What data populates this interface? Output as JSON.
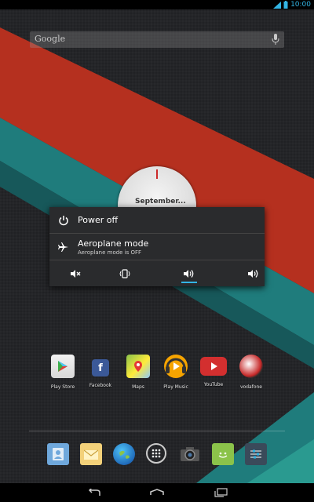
{
  "status_bar": {
    "time": "10:00"
  },
  "search": {
    "logo_text": "Google"
  },
  "clock_widget": {
    "date_label": "September..."
  },
  "power_menu": {
    "power_off_label": "Power off",
    "aeroplane_label": "Aeroplane mode",
    "aeroplane_status": "Aeroplane mode is OFF",
    "sound_modes": [
      "mute",
      "vibrate",
      "sound-on",
      "sound-on-alt"
    ],
    "selected_sound_mode": "sound-on"
  },
  "apps": [
    {
      "name": "Play Store"
    },
    {
      "name": "Facebook"
    },
    {
      "name": "Maps"
    },
    {
      "name": "Play Music"
    },
    {
      "name": "YouTube"
    },
    {
      "name": "vodafone"
    }
  ],
  "dock": [
    "contacts-icon",
    "email-icon",
    "browser-icon",
    "all-apps-icon",
    "camera-icon",
    "messaging-icon",
    "settings-icon"
  ],
  "colors": {
    "accent": "#33b5e5",
    "wall_red": "#b5301f",
    "wall_teal": "#1f7c7c",
    "dialog_bg": "#2a2b2d"
  }
}
